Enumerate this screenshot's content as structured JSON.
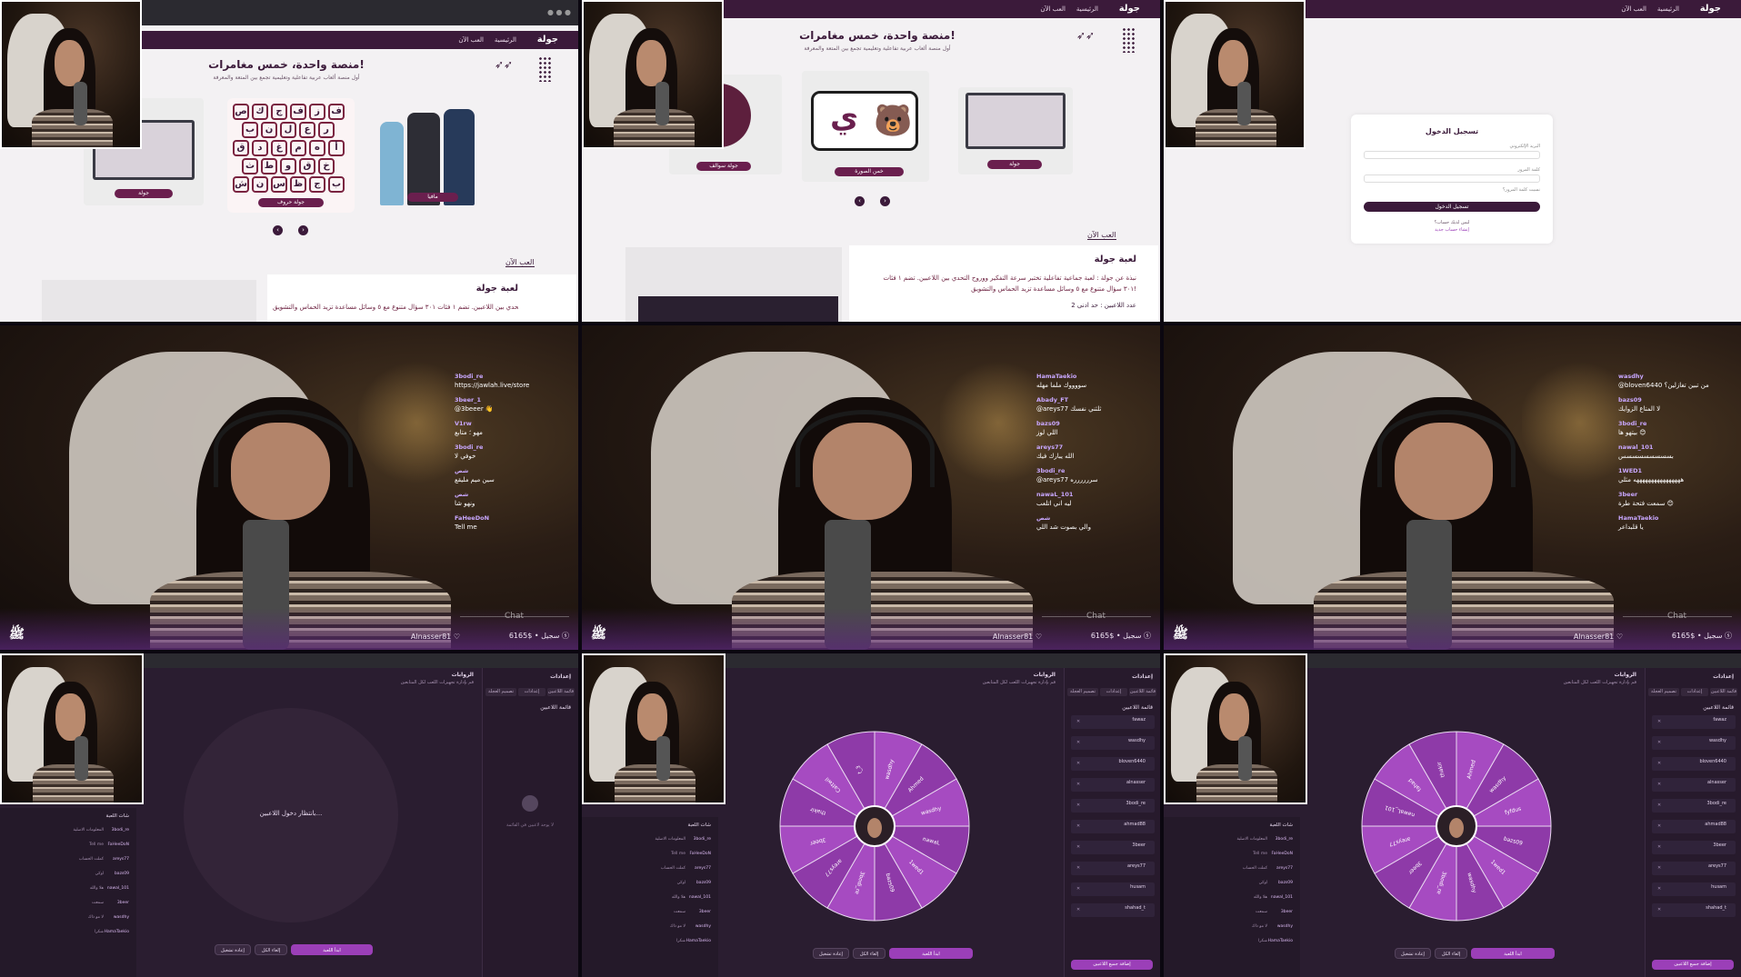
{
  "colors": {
    "brand": "#3b1a3a",
    "accent": "#9b3fb8",
    "pill": "#6a1f4e",
    "wheel_a": "#8e3aa8",
    "wheel_b": "#a64bc1"
  },
  "site": {
    "logo": "جولة",
    "nav": {
      "home": "الرئيسية",
      "play_now": "العب الآن"
    },
    "hero_title": "منصة واحدة، خمس مغامرات!",
    "hero_sub": "أول منصة ألعاب عربية تفاعلية وتعليمية تجمع بين المتعة والمعرفة",
    "cards": {
      "letters_pill": "جولة حروف",
      "spy_pill": "مافيا",
      "picture_pill": "خمن الصورة",
      "round_pill": "جولة",
      "trivia_pill": "جولة سوالف"
    },
    "bear_letter": "ي",
    "letters": [
      "ص",
      "ك",
      "ج",
      "ف",
      "ز",
      "ف",
      "ب",
      "ن",
      "ل",
      "ع",
      "ر",
      "ق",
      "د",
      "غ",
      "م",
      "ه",
      "أ",
      "ث",
      "ط",
      "و",
      "ق",
      "خ",
      "ش",
      "ن",
      "س",
      "ظ",
      "ج",
      "ب",
      "ت"
    ],
    "section_label": "العب الآن",
    "section_title": "لعبة جولة",
    "section_desc": "نبذة عن جولة : لعبة جماعية تفاعلية تختبر سرعة التفكير ووروح التحدي بين اللاعبين. تضم ١ فئات ٣٠١ سؤال متنوع مع ٥ وسائل مساعدة تزيد الحماس والتشويق!",
    "players_line": "عدد اللاعبين : حد ادنى 2"
  },
  "login": {
    "title": "تسجيل الدخول",
    "email_label": "البريد الإلكتروني",
    "email_placeholder": "أدخل بريدك الإلكتروني",
    "password_label": "كلمة المرور",
    "password_placeholder": "أدخل كلمة المرور",
    "forgot": "نسيت كلمة المرور؟",
    "submit": "تسجيل الدخول",
    "no_account": "ليس لديك حساب؟",
    "register": "إنشاء حساب جديد"
  },
  "stream": {
    "chat_label": "Chat",
    "streamer": "Alnasser81",
    "stats": "6165$ • سجيل",
    "chat1": [
      {
        "user": "3bodi_re",
        "text": "https://jawlah.live/store"
      },
      {
        "user": "3beer_1",
        "text": "@3beeer 👋"
      },
      {
        "user": "V1rw",
        "text": "مهو ؛ متابع"
      },
      {
        "user": "3bodi_re",
        "text": "خوفي لا"
      },
      {
        "user": "شص",
        "text": "سين ميم مليقع"
      },
      {
        "user": "شص",
        "text": "ونهو شا"
      },
      {
        "user": "FaHeeDoN",
        "text": "Tell me"
      }
    ],
    "chat2": [
      {
        "user": "HamaTaekio",
        "text": "سووووك ملما مهله"
      },
      {
        "user": "Abady_FT",
        "text": "@areys77 ثلثني نفسك"
      },
      {
        "user": "bazs09",
        "text": "اللي لوز"
      },
      {
        "user": "areys77",
        "text": "الله يبارك فيك"
      },
      {
        "user": "3bodi_re",
        "text": "@areys77 سرررررره"
      },
      {
        "user": "nawaL_101",
        "text": "ليه اني اتلعب"
      },
      {
        "user": "شص",
        "text": "والي بصوت شد اللي"
      }
    ],
    "chat3": [
      {
        "user": "wasdhy",
        "text": "@bloven6440 من تبين تغازلين؟"
      },
      {
        "user": "bazs09",
        "text": "لا المتاع الزوايك"
      },
      {
        "user": "3bodi_re",
        "text": "بيتهو ها 😊"
      },
      {
        "user": "nawal_101",
        "text": "بسسسسسسسسس"
      },
      {
        "user": "1WED1",
        "text": "ههههههههههههههههه مثلي"
      },
      {
        "user": "3beer",
        "text": "سمعت فتحة طرة 😊"
      },
      {
        "user": "HamaTaekio",
        "text": "يا قلبداعر"
      }
    ]
  },
  "dashboard": {
    "title": "الروابات",
    "subtitle": "قم بإدارة تجهيزات اللعب لكل المتابعين",
    "rp_title": "إعدادات",
    "tabs": [
      "قائمة اللاعبين",
      "إعدادات",
      "تصميم العجلة"
    ],
    "players_head": "قائمة اللاعبين",
    "empty_text": "لا يوجد لاعبين في القائمة",
    "waiting": "بانتظار دخول اللاعبين...",
    "chat_title": "شات اللعبة",
    "buttons": {
      "reset": "إعادة تشغيل",
      "clear": "إلغاء الكل",
      "start": "ابدأ اللعبة",
      "add_all": "إضافة جميع اللاعبين"
    },
    "players_list": [
      "fawaz",
      "wasdhy",
      "bloven6440",
      "alnasser",
      "3bodi_re",
      "ahmad88",
      "3beer",
      "areys77",
      "husam",
      "shahad_t"
    ],
    "wheel_names1": [
      "wasdhy",
      "Ahmed",
      "wasdhy",
      "nawaL",
      "1wed1",
      "bazs09",
      "3bodi_re",
      "areys77",
      "3beer",
      "thakir",
      "Cattwil",
      "t_3"
    ],
    "wheel_names2": [
      "Ahmed",
      "wasdhy",
      "fyfdus",
      "bazs09",
      "1wed1",
      "wasdhy",
      "3bodi_re",
      "3beer",
      "areys77",
      "nawaL_101",
      "fahad",
      "thakir"
    ],
    "chat_lines": [
      {
        "u": "3bodi_re",
        "t": "المعلومات الاصلية"
      },
      {
        "u": "FaHeeDoN",
        "t": "Tell me"
      },
      {
        "u": "areys77",
        "t": "كملت الحساب"
      },
      {
        "u": "bazs09",
        "t": "اوكي"
      },
      {
        "u": "nawal_101",
        "t": "هلا والله"
      },
      {
        "u": "3beer",
        "t": "سمعت"
      },
      {
        "u": "wasdhy",
        "t": "لا مو ذاك"
      },
      {
        "u": "HamaTaekio",
        "t": "شكرا"
      }
    ]
  }
}
